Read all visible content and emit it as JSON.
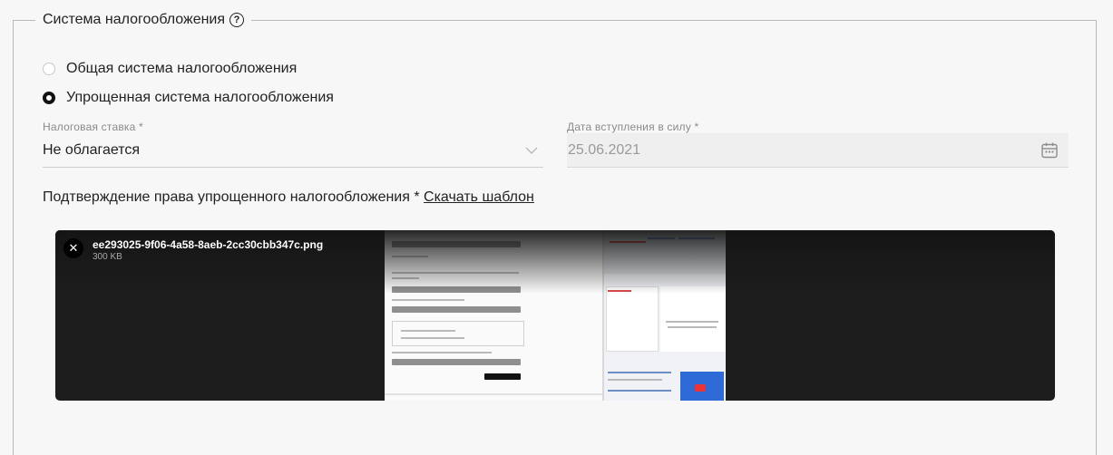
{
  "section": {
    "title": "Система налогообложения",
    "help_icon": "question-circle-icon"
  },
  "tax_options": [
    {
      "label": "Общая система налогообложения",
      "selected": false
    },
    {
      "label": "Упрощенная система налогообложения",
      "selected": true
    }
  ],
  "tax_rate": {
    "label": "Налоговая ставка *",
    "value": "Не облагается"
  },
  "effective_date": {
    "label": "Дата вступления в силу *",
    "value": "25.06.2021"
  },
  "confirmation": {
    "text": "Подтверждение права упрощенного налогообложения * ",
    "download_link": "Скачать шаблон"
  },
  "uploaded_file": {
    "name": "ee293025-9f06-4a58-8aeb-2cc30cbb347c.png",
    "size": "300 KB"
  }
}
